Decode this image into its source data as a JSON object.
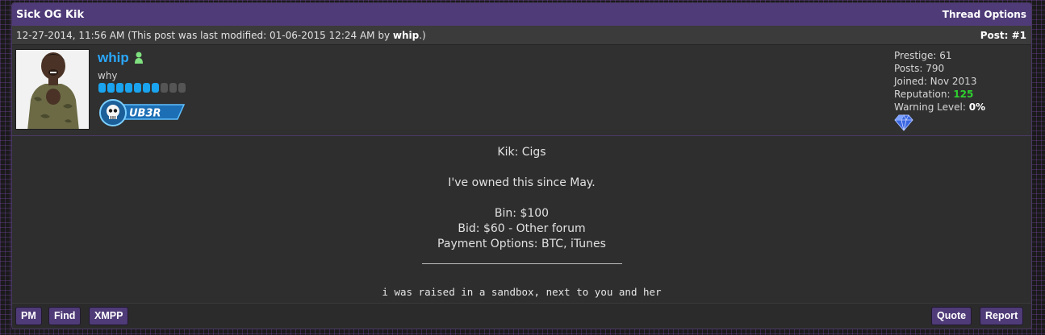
{
  "thread": {
    "title": "Sick OG Kik",
    "options_label": "Thread Options"
  },
  "post": {
    "date": "12-27-2014, 11:56 AM",
    "modified_prefix": "(This post was last modified: 01-06-2015 12:24 AM by",
    "modified_by": "whip",
    "modified_suffix": ".)",
    "number": "Post: #1"
  },
  "author": {
    "username": "whip",
    "usertitle": "why",
    "stars_filled": 7,
    "stars_total": 10,
    "group_badge": "UB3R",
    "online_icon": "user-online-icon",
    "accent_color": "#2aa8ff"
  },
  "stats": {
    "prestige": "Prestige: 61",
    "posts": "Posts: 790",
    "joined": "Joined: Nov 2013",
    "reputation_label": "Reputation:",
    "reputation_value": "125",
    "warning_label": "Warning Level:",
    "warning_value": "0%",
    "award_icon": "diamond-icon"
  },
  "body": {
    "lines": [
      "Kik: Cigs",
      "I've owned this since May.",
      "Bin: $100",
      "Bid: $60 - Other forum",
      "Payment Options: BTC, iTunes"
    ],
    "signature": "i was raised in a sandbox, next to you and her"
  },
  "controls": {
    "pm": "PM",
    "find": "Find",
    "xmpp": "XMPP",
    "quote": "Quote",
    "report": "Report"
  },
  "colors": {
    "header_bg": "#4f3b77",
    "button_bg": "#4f3b77",
    "reputation": "#2fd02f",
    "username": "#2aa8ff"
  }
}
